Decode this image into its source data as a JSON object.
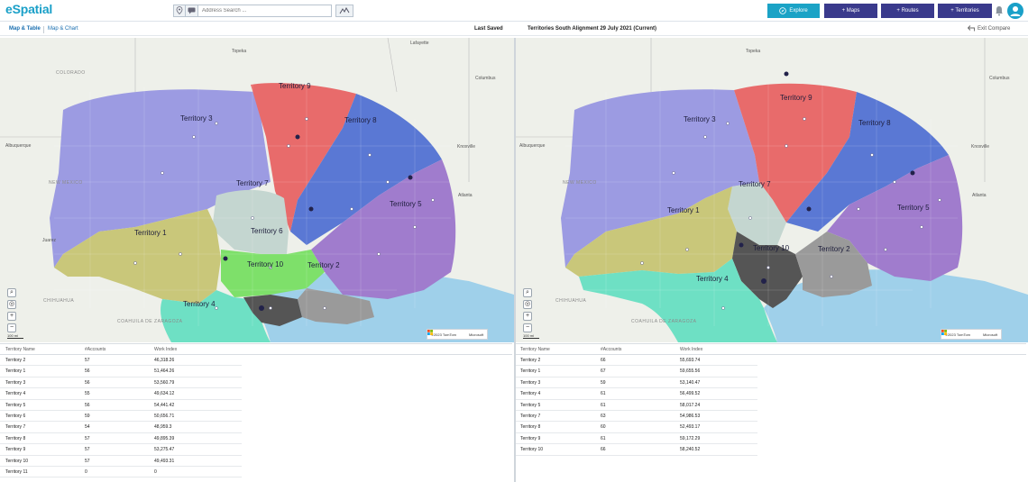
{
  "header": {
    "logo": "eSpatial",
    "search_placeholder": "Address Search ...",
    "buttons": {
      "explore": "Explore",
      "maps": "+ Maps",
      "routes": "+ Routes",
      "territories": "+ Territories"
    }
  },
  "subbar": {
    "tab_map_table": "Map & Table",
    "tab_map_chart": "Map & Chart",
    "last_saved": "Last Saved",
    "alignment_title": "Territories South Alignment 29 July 2021 (Current)",
    "exit_compare": "Exit Compare"
  },
  "map_left": {
    "territories": [
      "Territory 9",
      "Territory 3",
      "Territory 8",
      "Territory 7",
      "Territory 5",
      "Territory 1",
      "Territory 6",
      "Territory 10",
      "Territory 2",
      "Territory 4"
    ],
    "cities": [
      "COLORADO",
      "Albuquerque",
      "NEW MEXICO",
      "Juarez",
      "CHIHUAHUA",
      "COAHUILA DE ZARAGOZA",
      "Knoxville",
      "Atlanta",
      "Columbus",
      "Lafayette",
      "Topeka"
    ],
    "attribution": "©2023 TomTom",
    "attribution_ms": "Microsoft",
    "scale": "100 mi"
  },
  "map_right": {
    "territories": [
      "Territory 9",
      "Territory 3",
      "Territory 8",
      "Territory 7",
      "Territory 1",
      "Territory 5",
      "Territory 10",
      "Territory 2",
      "Territory 4"
    ],
    "cities": [
      "Albuquerque",
      "NEW MEXICO",
      "CHIHUAHUA",
      "COAHUILA DE ZARAGOZA",
      "Knoxville",
      "Atlanta",
      "Columbus",
      "Topeka"
    ],
    "attribution": "©2023 TomTom",
    "attribution_ms": "Microsoft",
    "scale": "100 mi"
  },
  "table_columns": [
    "Territory Name",
    "#Accounts",
    "Work Index"
  ],
  "table_left": [
    [
      "Territory 2",
      "57",
      "46,318.26"
    ],
    [
      "Territory 1",
      "56",
      "51,464.26"
    ],
    [
      "Territory 3",
      "56",
      "53,560.79"
    ],
    [
      "Territory 4",
      "55",
      "49,634.12"
    ],
    [
      "Territory 5",
      "56",
      "54,441.42"
    ],
    [
      "Territory 6",
      "59",
      "50,656.71"
    ],
    [
      "Territory 7",
      "54",
      "48,959.3"
    ],
    [
      "Territory 8",
      "57",
      "49,895.39"
    ],
    [
      "Territory 9",
      "57",
      "53,275.47"
    ],
    [
      "Territory 10",
      "57",
      "49,493.31"
    ],
    [
      "Territory 11",
      "0",
      "0"
    ]
  ],
  "table_right": [
    [
      "Territory 2",
      "66",
      "55,693.74"
    ],
    [
      "Territory 1",
      "67",
      "59,655.56"
    ],
    [
      "Territory 3",
      "59",
      "53,140.47"
    ],
    [
      "Territory 4",
      "61",
      "56,499.52"
    ],
    [
      "Territory 5",
      "61",
      "58,017.24"
    ],
    [
      "Territory 7",
      "63",
      "54,986.53"
    ],
    [
      "Territory 8",
      "60",
      "52,493.17"
    ],
    [
      "Territory 9",
      "61",
      "59,172.29"
    ],
    [
      "Territory 10",
      "66",
      "58,240.52"
    ]
  ],
  "colors": {
    "explore": "#1ba3c6",
    "nav": "#3a3a8c",
    "water": "#9fd0ea",
    "territory_1": "#c9c77a",
    "territory_2": "#9a9a9a",
    "territory_3": "#9c9be2",
    "territory_4": "#6ee0c4",
    "territory_5": "#a07ccd",
    "territory_6": "#7ee06a",
    "territory_7": "#c4d6d0",
    "territory_8": "#5a78d4",
    "territory_9": "#e86b6b",
    "territory_10": "#555555"
  }
}
